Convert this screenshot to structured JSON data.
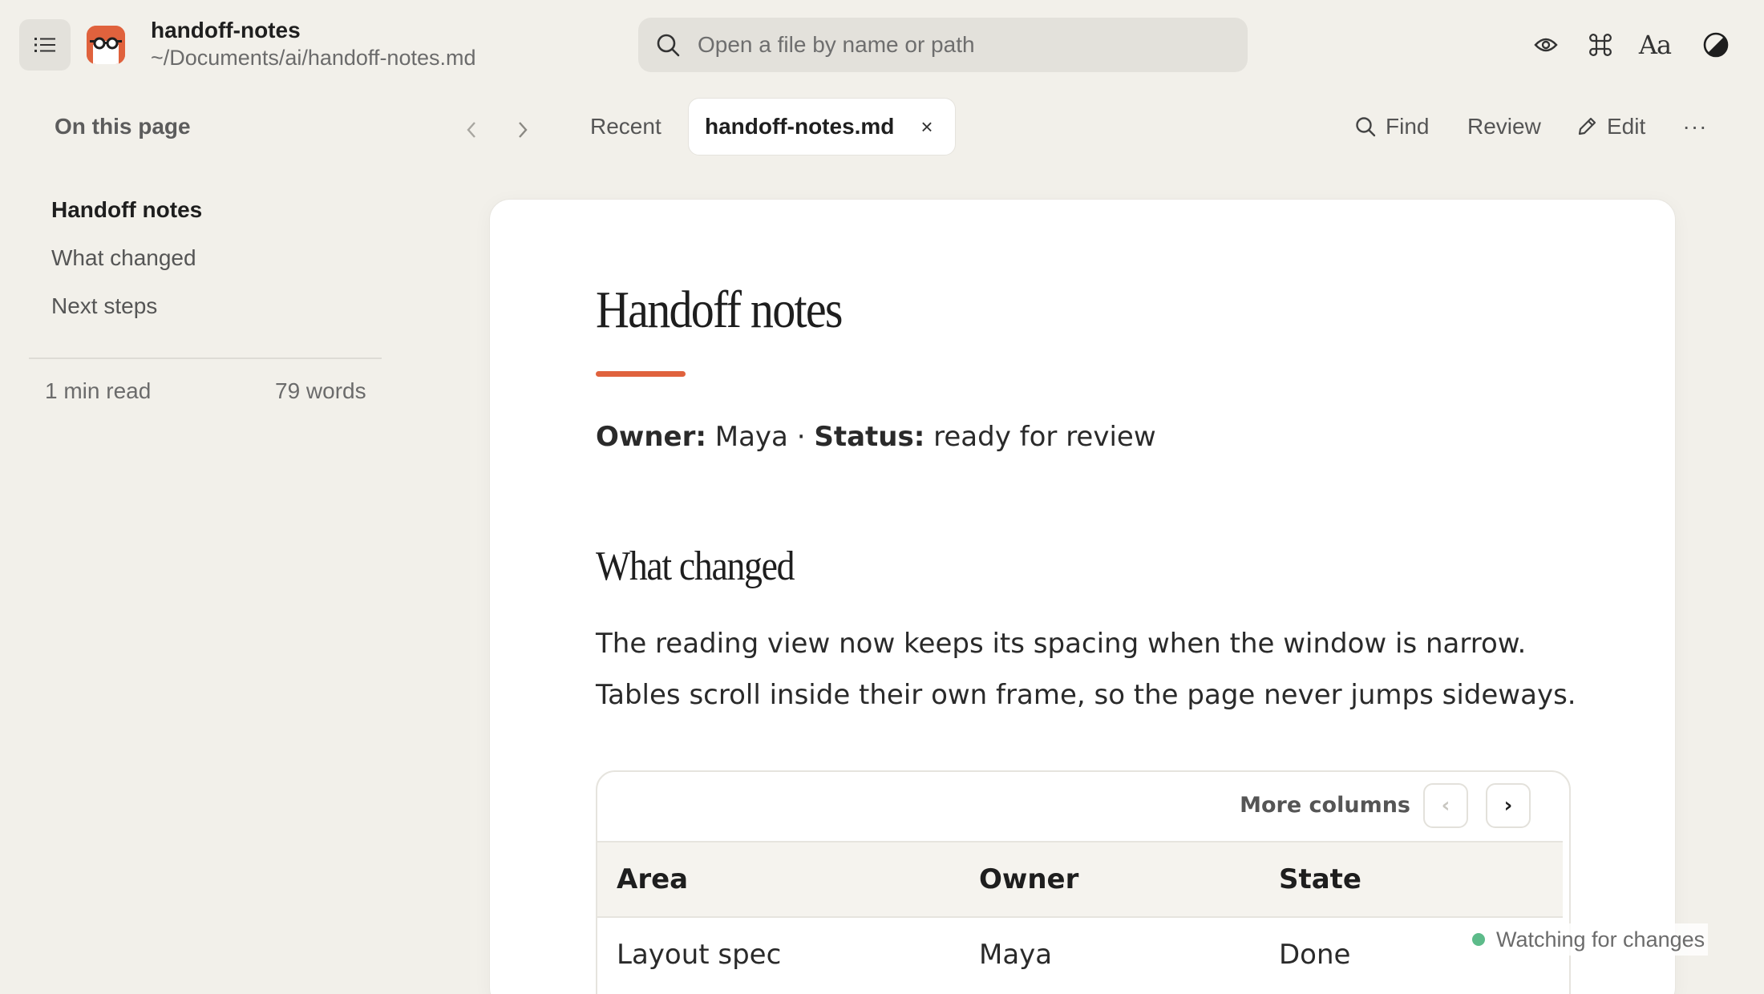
{
  "titlebar": {
    "file_title": "handoff-notes",
    "file_path": "~/Documents/ai/handoff-notes.md",
    "search_placeholder": "Open a file by name or path",
    "icons": [
      "list-icon",
      "app-logo-glasses-icon",
      "search-icon",
      "eye-icon",
      "command-icon",
      "font-icon",
      "contrast-icon"
    ],
    "font_icon_text": "Aa"
  },
  "outline": {
    "heading": "On this page",
    "items": [
      {
        "label": "Handoff notes",
        "active": true
      },
      {
        "label": "What changed",
        "active": false
      },
      {
        "label": "Next steps",
        "active": false
      }
    ],
    "read_time": "1 min read",
    "word_count": "79 words"
  },
  "tabs": {
    "recent_label": "Recent",
    "active_tab_label": "handoff-notes.md",
    "close_glyph": "×"
  },
  "toolbar": {
    "find_label": "Find",
    "review_label": "Review",
    "edit_label": "Edit",
    "more_glyph": "···"
  },
  "document": {
    "title": "Handoff notes",
    "meta": {
      "owner_label": "Owner:",
      "owner_value": "Maya",
      "separator": "·",
      "status_label": "Status:",
      "status_value": "ready for review"
    },
    "section_heading": "What changed",
    "paragraph": "The reading view now keeps its spacing when the window is narrow. Tables scroll inside their own frame, so the page never jumps sideways.",
    "table": {
      "more_columns_label": "More columns",
      "prev_glyph": "‹",
      "next_glyph": "›",
      "headers": [
        "Area",
        "Owner",
        "State"
      ],
      "rows": [
        [
          "Layout spec",
          "Maya",
          "Done"
        ]
      ]
    }
  },
  "status": {
    "watching_label": "Watching for changes"
  },
  "colors": {
    "accent": "#e0623d",
    "background": "#f2f0ea",
    "status_dot": "#5dbb8a"
  }
}
